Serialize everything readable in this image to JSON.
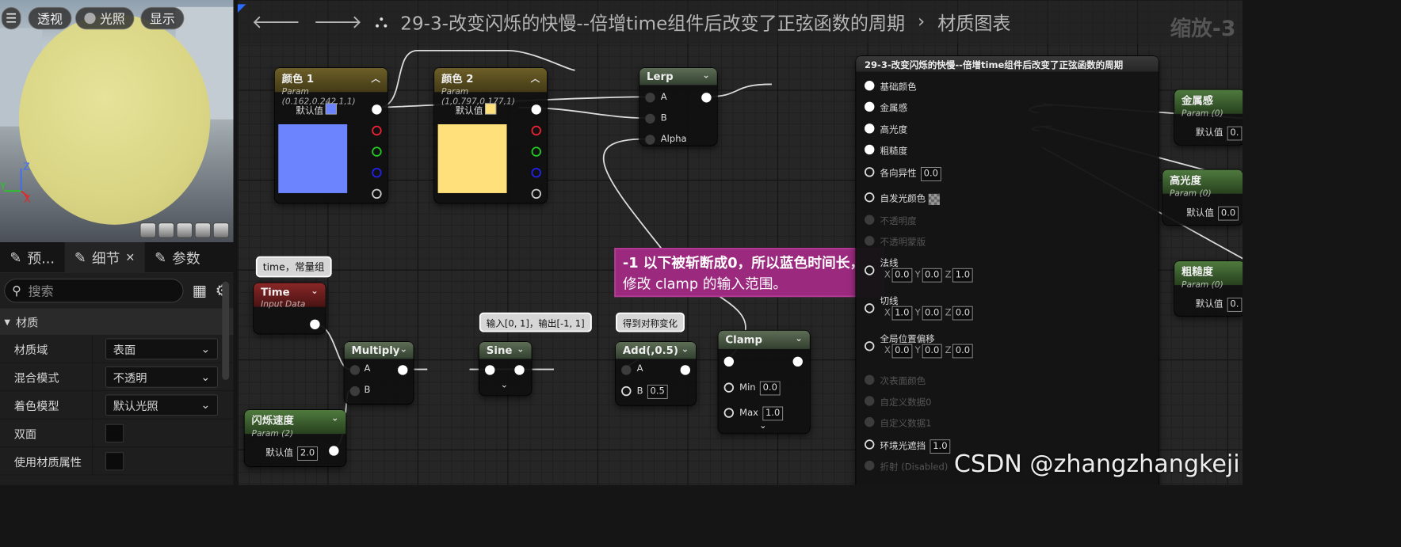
{
  "viewport": {
    "buttons": {
      "perspective": "透视",
      "lit": "光照",
      "show": "显示"
    },
    "axes": {
      "z": "Z",
      "x": "X",
      "y": "Y"
    }
  },
  "panel": {
    "tabs": [
      {
        "label": "预..."
      },
      {
        "label": "细节"
      },
      {
        "label": "参数"
      }
    ],
    "search_placeholder": "搜索",
    "category": "材质",
    "props": [
      {
        "label": "材质域",
        "value": "表面"
      },
      {
        "label": "混合模式",
        "value": "不透明"
      },
      {
        "label": "着色模型",
        "value": "默认光照"
      },
      {
        "label": "双面",
        "value": ""
      },
      {
        "label": "使用材质属性",
        "value": ""
      }
    ]
  },
  "toolbar": {
    "title": "29-3-改变闪烁的快慢--倍增time组件后改变了正弦函数的周期",
    "tail": "材质图表",
    "zoom": "缩放-3"
  },
  "nodes": {
    "color1": {
      "title": "颜色 1",
      "sub": "Param (0.162,0.242,1,1)",
      "default_label": "默认值",
      "swatch": "#6d84ff"
    },
    "color2": {
      "title": "颜色 2",
      "sub": "Param (1,0.797,0.177,1)",
      "default_label": "默认值",
      "swatch": "#ffe07a"
    },
    "lerp": {
      "title": "Lerp",
      "a": "A",
      "b": "B",
      "alpha": "Alpha"
    },
    "time": {
      "title": "Time",
      "sub": "Input Data"
    },
    "multiply": {
      "title": "Multiply",
      "a": "A",
      "b": "B"
    },
    "sine": {
      "title": "Sine"
    },
    "add": {
      "title": "Add(,0.5)",
      "a": "A",
      "b": "B",
      "b_value": "0.5"
    },
    "clamp": {
      "title": "Clamp",
      "min": "Min",
      "min_value": "0.0",
      "max": "Max",
      "max_value": "1.0"
    },
    "flash": {
      "title": "闪烁速度",
      "sub": "Param (2)",
      "default_label": "默认值",
      "value": "2.0"
    },
    "metal": {
      "title": "金属感",
      "sub": "Param (0)",
      "default_label": "默认值",
      "value": "0."
    },
    "spec": {
      "title": "高光度",
      "sub": "Param (0)",
      "default_label": "默认值",
      "value": "0.0"
    },
    "rough": {
      "title": "粗糙度",
      "sub": "Param (0)",
      "default_label": "默认值",
      "value": "0."
    }
  },
  "comments": {
    "time": "time，常量组",
    "sine": "输入[0, 1]，输出[-1, 1]",
    "add": "得到对称变化",
    "main_line1": "-1 以下被斩断成0，所以蓝色时间长，",
    "main_line2": "修改 clamp 的输入范围。"
  },
  "result": {
    "title": "29-3-改变闪烁的快慢--倍增time组件后改变了正弦函数的周期",
    "pins": {
      "base_color": "基础颜色",
      "metallic": "金属感",
      "specular": "高光度",
      "roughness": "粗糙度",
      "anisotropy": "各向异性",
      "anisotropy_value": "0.0",
      "emissive": "自发光颜色",
      "opacity": "不透明度",
      "opacity_mask": "不透明蒙版",
      "normal": "法线",
      "tangent": "切线",
      "wpo": "全局位置偏移",
      "subsurface": "次表面颜色",
      "custom0": "自定义数据0",
      "custom1": "自定义数据1",
      "ao": "环境光遮挡",
      "ao_value": "1.0",
      "refraction": "折射 (Disabled)"
    },
    "normal_vals": [
      "0.0",
      "0.0",
      "1.0"
    ],
    "tangent_vals": [
      "1.0",
      "0.0",
      "0.0"
    ],
    "wpo_vals": [
      "0.0",
      "0.0",
      "0.0"
    ],
    "axis": {
      "x": "X",
      "y": "Y",
      "z": "Z"
    }
  },
  "watermark": "CSDN @zhangzhangkeji"
}
